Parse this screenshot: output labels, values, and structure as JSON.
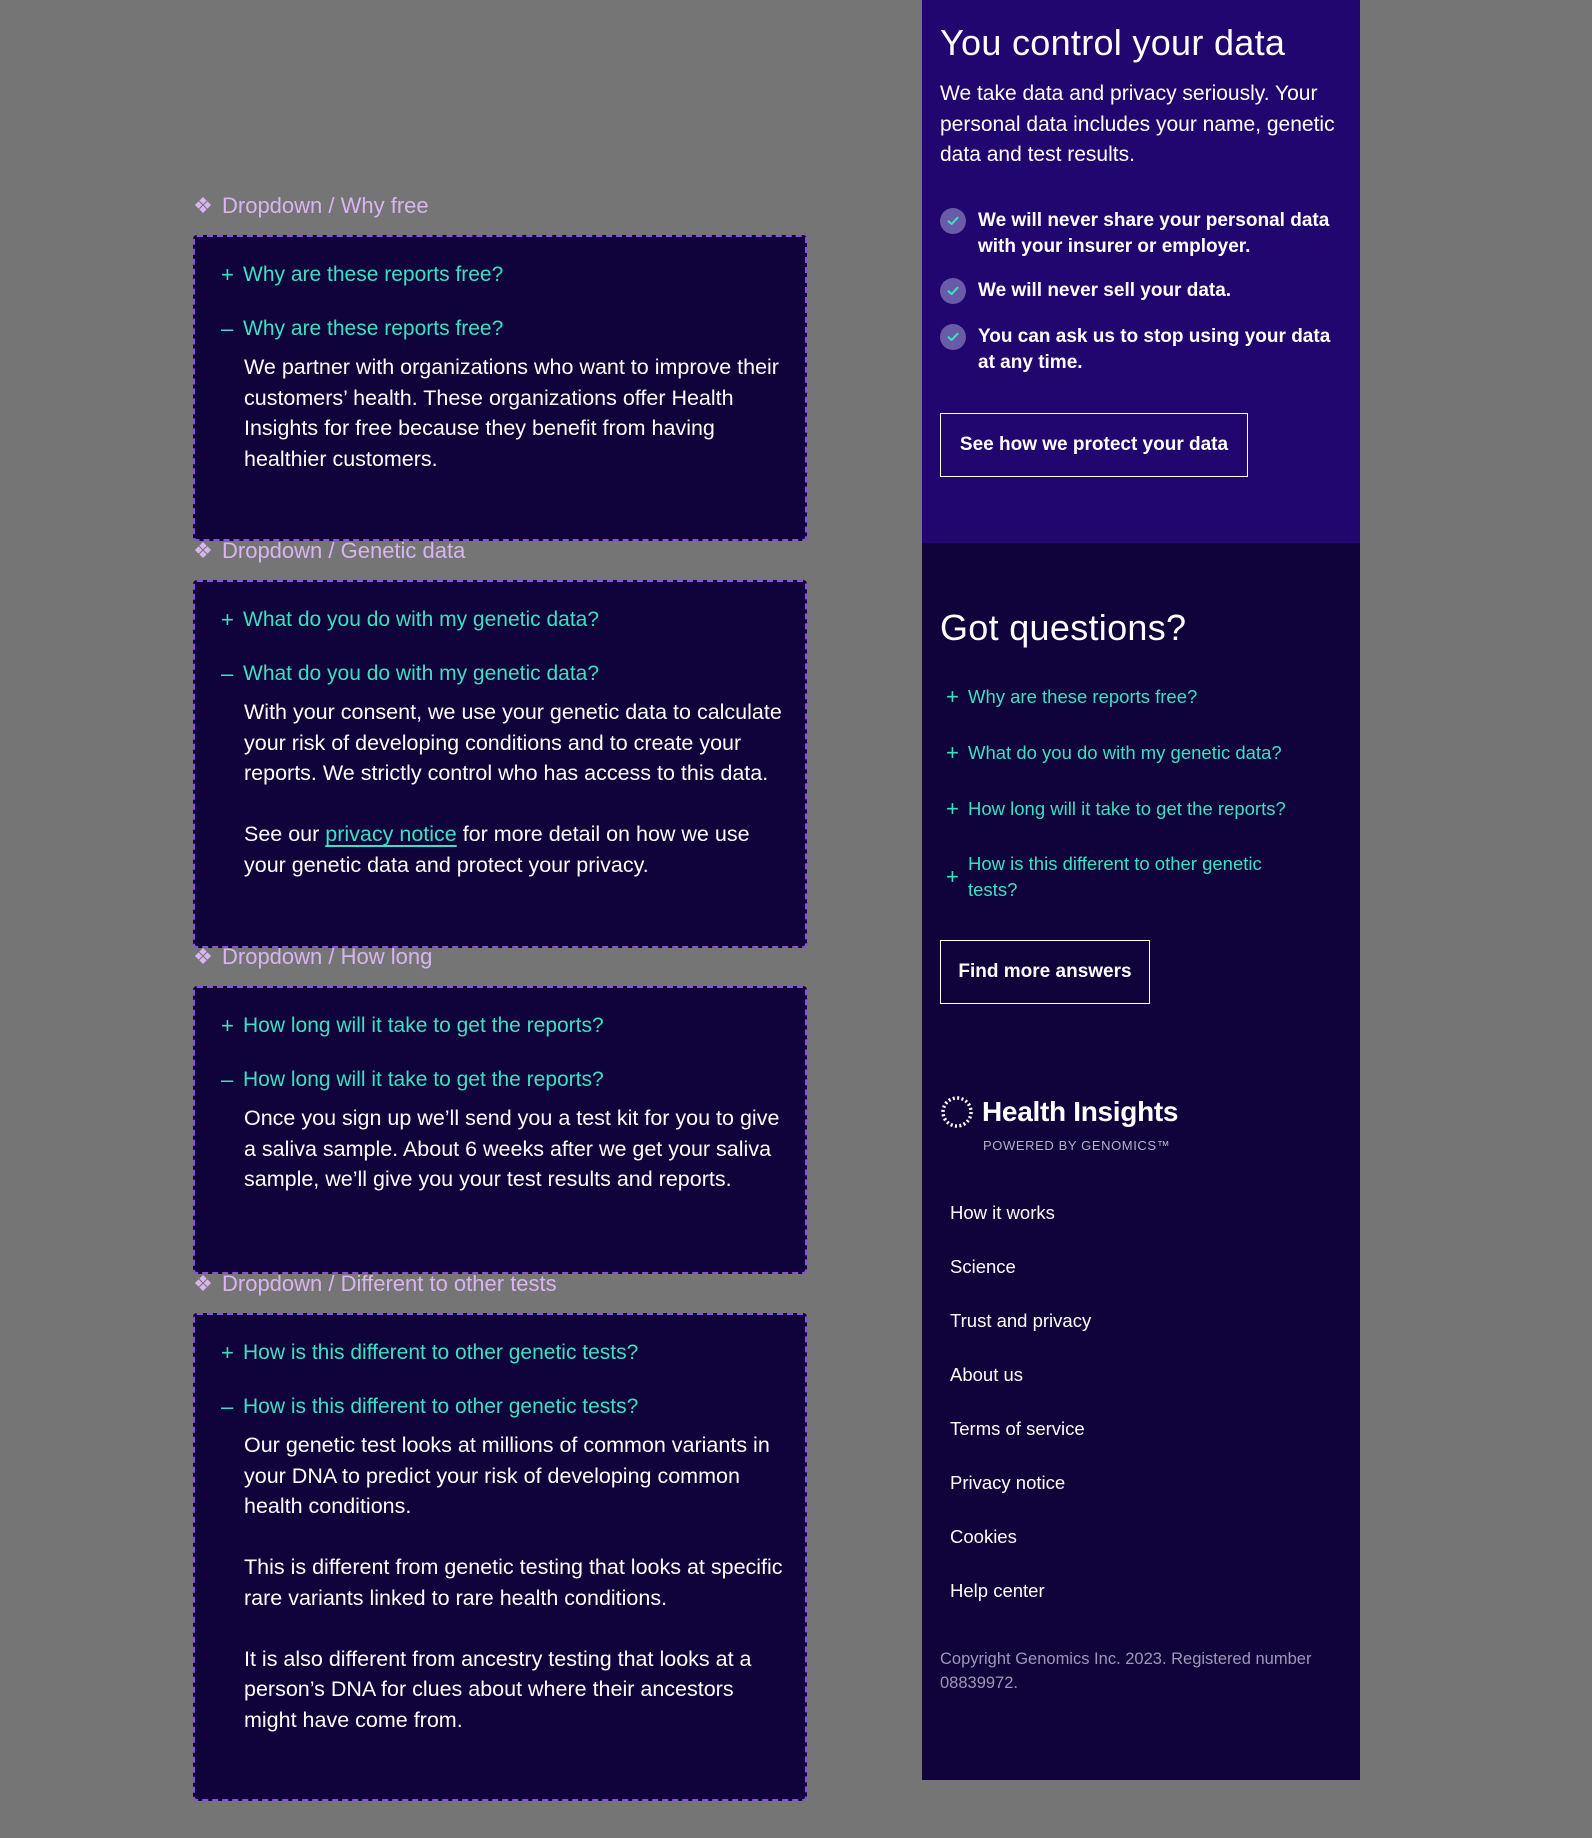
{
  "components": [
    {
      "label": "Dropdown / Why free",
      "question": "Why are these reports free?",
      "answer": [
        "We partner with organizations who want to improve their customers’ health. These organizations offer Health Insights for free because they benefit from having healthier customers."
      ]
    },
    {
      "label": "Dropdown / Genetic data",
      "question": "What do you do with my genetic data?",
      "answer": [
        "With your consent, we use your genetic data to calculate your risk of developing conditions and to create your reports. We strictly control who has access to this data."
      ],
      "answer_link_prefix": "See our ",
      "answer_link_text": "privacy notice",
      "answer_link_suffix": " for more detail on how we use your genetic data and protect your privacy."
    },
    {
      "label": "Dropdown / How long",
      "question": "How long will it take to get the reports?",
      "answer": [
        "Once you sign up we’ll send you a test kit for you to give a saliva sample. About 6 weeks after we get your saliva sample, we’ll give you your test results and reports."
      ]
    },
    {
      "label": "Dropdown / Different to other tests",
      "question": "How is this different to other genetic tests?",
      "answer": [
        "Our genetic test looks at millions of common variants in your DNA to predict your risk of developing common health conditions.",
        "This is different from genetic testing that looks at specific rare variants linked to rare health conditions.",
        "It is also different from ancestry testing that looks at a person’s DNA for clues about where their ancestors might have come from."
      ]
    }
  ],
  "icons": {
    "component": "diamond-cluster",
    "expand": "+",
    "collapse": "–",
    "check": "check-circle",
    "logo": "dotted-ring"
  },
  "data_panel": {
    "title": "You control your data",
    "intro": "We take data and privacy seriously. Your personal data includes your name, genetic data and test results.",
    "points": [
      "We will never share your personal data with your insurer or employer.",
      "We will never sell your data.",
      "You can ask us to stop using your data at any time."
    ],
    "button": "See how we protect your data"
  },
  "questions_panel": {
    "title": "Got questions?",
    "items": [
      "Why are these reports free?",
      "What do you do with my genetic data?",
      "How long will it take to get the reports?",
      "How is this different to other genetic tests?"
    ],
    "button": "Find more answers"
  },
  "footer": {
    "brand": "Health Insights",
    "tagline": "POWERED BY GENOMICS™",
    "links": [
      "How it works",
      "Science",
      "Trust and privacy",
      "About us",
      "Terms of service",
      "Privacy notice",
      "Cookies",
      "Help center"
    ],
    "copyright": "Copyright Genomics Inc. 2023. Registered number 08839972."
  },
  "colors": {
    "canvas": "#757575",
    "frame_bg": "#10023a",
    "frame_border": "#8a4fe0",
    "accent_teal": "#3de0c0",
    "label_lilac": "#d8b4f0",
    "panel_purple": "#22066f",
    "panel_dark": "#10023a"
  }
}
